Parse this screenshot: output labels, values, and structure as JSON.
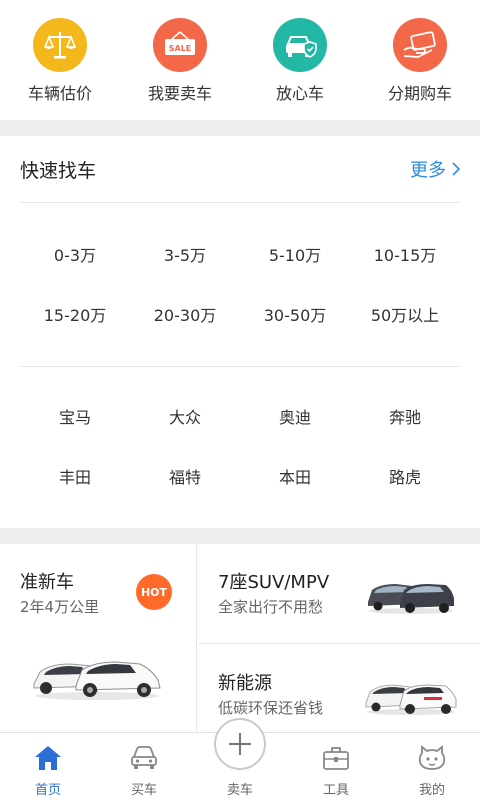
{
  "services": [
    {
      "label": "车辆估价",
      "icon": "scale-icon",
      "color": "#f5b81c"
    },
    {
      "label": "我要卖车",
      "icon": "sale-tag-icon",
      "color": "#f4684a",
      "badge": "SALE"
    },
    {
      "label": "放心车",
      "icon": "car-shield-icon",
      "color": "#22b8a5"
    },
    {
      "label": "分期购车",
      "icon": "hand-card-icon",
      "color": "#f4684a"
    }
  ],
  "quick_find": {
    "title": "快速找车",
    "more": "更多",
    "price_ranges": [
      "0-3万",
      "3-5万",
      "5-10万",
      "10-15万",
      "15-20万",
      "20-30万",
      "30-50万",
      "50万以上"
    ],
    "brands": [
      "宝马",
      "大众",
      "奥迪",
      "奔驰",
      "丰田",
      "福特",
      "本田",
      "路虎"
    ]
  },
  "categories": {
    "near_new": {
      "title": "准新车",
      "subtitle": "2年4万公里",
      "badge": "HOT"
    },
    "suv_mpv": {
      "title": "7座SUV/MPV",
      "subtitle": "全家出行不用愁"
    },
    "new_energy": {
      "title": "新能源",
      "subtitle": "低碳环保还省钱"
    }
  },
  "tabbar": [
    {
      "label": "首页",
      "icon": "home-icon",
      "active": true
    },
    {
      "label": "买车",
      "icon": "car-front-icon",
      "active": false
    },
    {
      "label": "卖车",
      "icon": "plus-icon",
      "active": false
    },
    {
      "label": "工具",
      "icon": "toolbox-icon",
      "active": false
    },
    {
      "label": "我的",
      "icon": "profile-face-icon",
      "active": false
    }
  ],
  "colors": {
    "accent": "#2b8be8",
    "active_tab": "#2b6fd6",
    "hot": "#ff6a2b",
    "gap": "#eceef0"
  }
}
